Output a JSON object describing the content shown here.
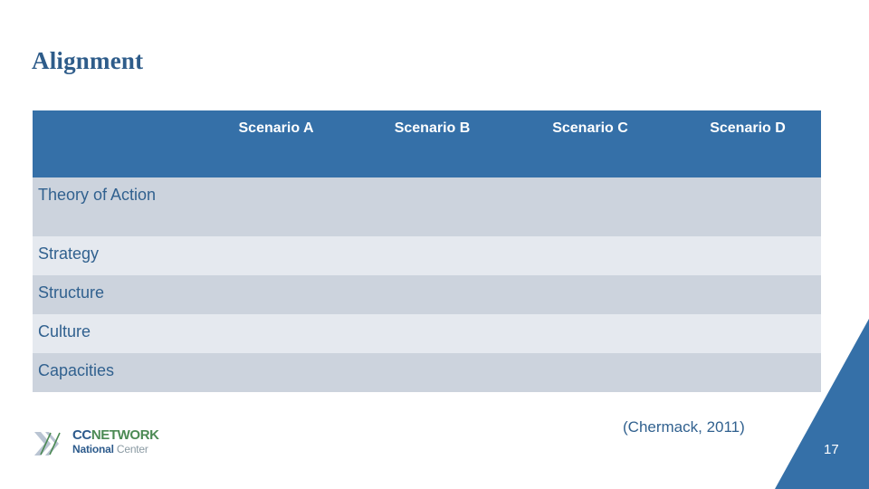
{
  "slide": {
    "title": "Alignment",
    "citation": "(Chermack, 2011)",
    "page_number": "17"
  },
  "table": {
    "columns": [
      "",
      "Scenario A",
      "Scenario B",
      "Scenario C",
      "Scenario D"
    ],
    "rows": [
      {
        "label": "Theory of Action",
        "cells": [
          "",
          "",
          "",
          ""
        ]
      },
      {
        "label": "Strategy",
        "cells": [
          "",
          "",
          "",
          ""
        ]
      },
      {
        "label": "Structure",
        "cells": [
          "",
          "",
          "",
          ""
        ]
      },
      {
        "label": "Culture",
        "cells": [
          "",
          "",
          "",
          ""
        ]
      },
      {
        "label": "Capacities",
        "cells": [
          "",
          "",
          "",
          ""
        ]
      }
    ]
  },
  "logo": {
    "mark": "double-chevron-icon",
    "line1_part1": "CC",
    "line1_part2": "NETWORK",
    "line2_part1": "National ",
    "line2_part2": "Center"
  },
  "colors": {
    "header_blue": "#3570a8",
    "title_blue": "#2e5c8a",
    "row_dark": "#ccd3dd",
    "row_light": "#e5e9ef",
    "label_text": "#31618f",
    "logo_green": "#4c8a54",
    "corner_blue": "#3570a8"
  }
}
